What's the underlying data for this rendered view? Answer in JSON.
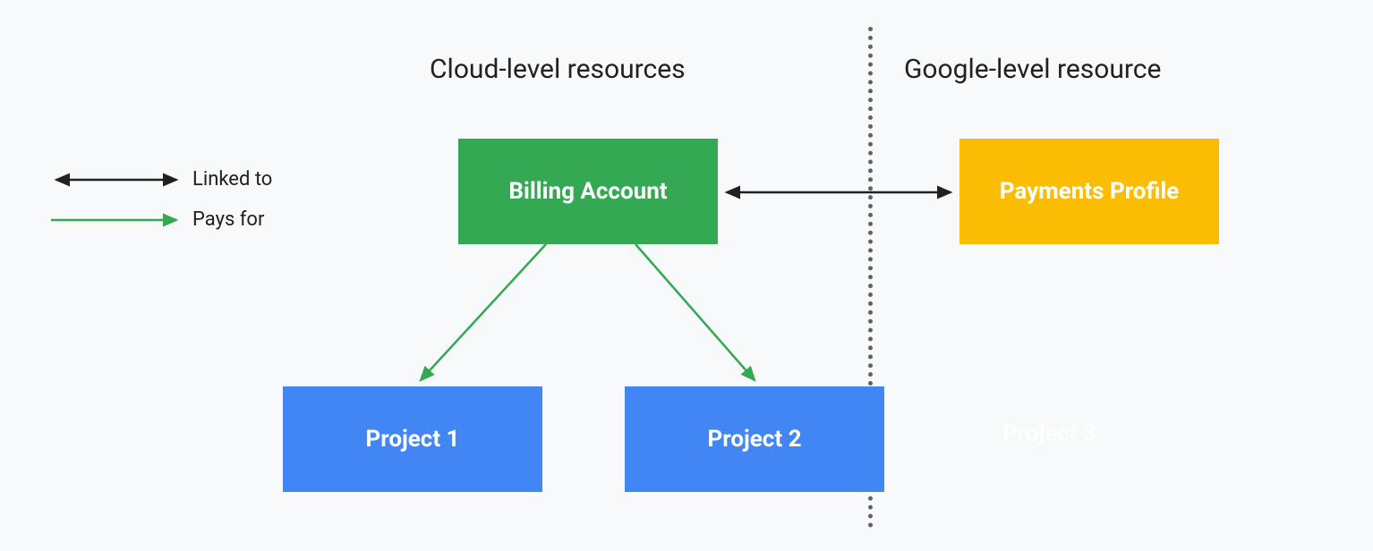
{
  "headings": {
    "cloud_level": "Cloud-level resources",
    "google_level": "Google-level resource"
  },
  "legend": {
    "linked_to": "Linked to",
    "pays_for": "Pays for"
  },
  "boxes": {
    "billing_account": "Billing Account",
    "payments_profile": "Payments Profile",
    "project1": "Project 1",
    "project2": "Project 2",
    "project3": "Project 3"
  },
  "colors": {
    "green": "#34a853",
    "yellow": "#fbbc04",
    "blue": "#4285f4",
    "dark": "#202124",
    "arrow_dark": "#202124",
    "arrow_green": "#34a853"
  }
}
